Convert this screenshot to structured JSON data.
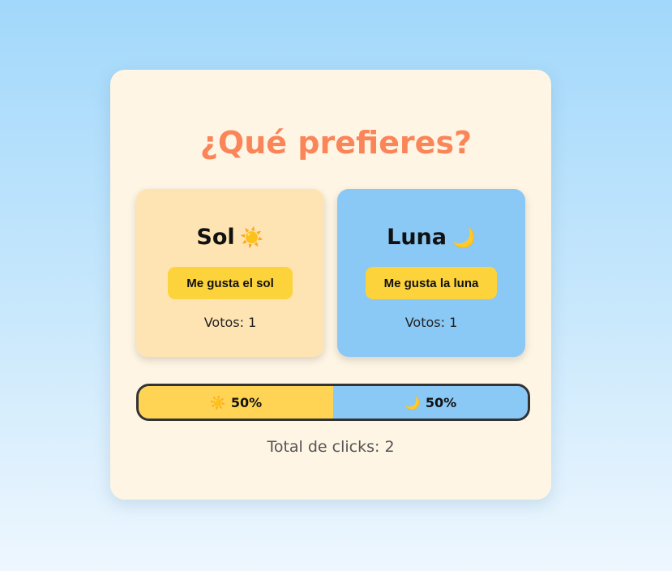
{
  "title": "¿Qué prefieres?",
  "options": [
    {
      "name": "Sol",
      "emoji": "☀️",
      "button_label": "Me gusta el sol",
      "votes_text": "Votos: 1",
      "color": "#ffe4b3"
    },
    {
      "name": "Luna",
      "emoji": "🌙",
      "button_label": "Me gusta la luna",
      "votes_text": "Votos: 1",
      "color": "#8ac8f6"
    }
  ],
  "bar": {
    "sol": {
      "emoji": "☀️",
      "label": "50%",
      "percent": 50,
      "color": "#ffd454"
    },
    "luna": {
      "emoji": "🌙",
      "label": "50%",
      "percent": 50,
      "color": "#8ac8f6"
    }
  },
  "total_text": "Total de clicks: 2",
  "colors": {
    "title": "#fa8559",
    "button": "#fdd33c",
    "card": "#fff5e4"
  }
}
